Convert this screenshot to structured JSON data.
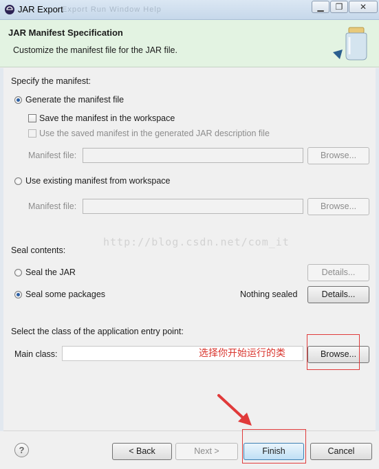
{
  "window": {
    "title": "JAR Export",
    "ghost_menu": "Export   Run   Window   Help",
    "minimize": "▁",
    "maximize": "❐",
    "close": "✕"
  },
  "banner": {
    "heading": "JAR Manifest Specification",
    "subtitle": "Customize the manifest file for the JAR file."
  },
  "manifest": {
    "section_label": "Specify the manifest:",
    "generate_label": "Generate the manifest file",
    "generate_selected": true,
    "save_in_workspace_label": "Save the manifest in the workspace",
    "use_saved_label": "Use the saved manifest in the generated JAR description file",
    "manifest_file_label": "Manifest file:",
    "manifest_file_value": "",
    "browse_label": "Browse...",
    "use_existing_label": "Use existing manifest from workspace",
    "existing_manifest_file_label": "Manifest file:",
    "existing_browse_label": "Browse..."
  },
  "watermark": "http://blog.csdn.net/com_it",
  "seal": {
    "section_label": "Seal contents:",
    "seal_jar_label": "Seal the JAR",
    "seal_jar_details": "Details...",
    "seal_packages_label": "Seal some packages",
    "seal_packages_selected": true,
    "nothing_sealed": "Nothing sealed",
    "seal_packages_details": "Details..."
  },
  "entry": {
    "section_label": "Select the class of the application entry point:",
    "main_class_label": "Main class:",
    "main_class_value": "",
    "annotation": "选择你开始运行的类",
    "browse_label": "Browse..."
  },
  "footer": {
    "help": "?",
    "back": "< Back",
    "next": "Next >",
    "finish": "Finish",
    "cancel": "Cancel"
  },
  "colors": {
    "banner_bg": "#e3f3e2",
    "annotation_red": "#e03a3a",
    "selection_blue": "#2a5fa5"
  }
}
